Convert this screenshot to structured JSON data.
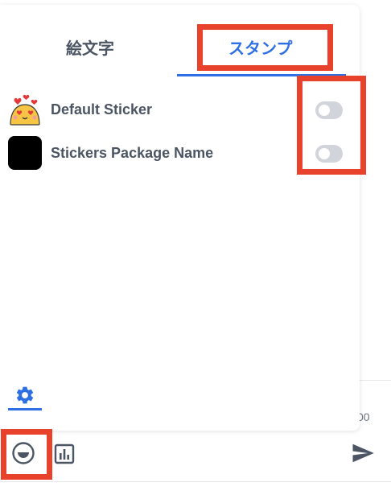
{
  "tabs": {
    "emoji_label": "絵文字",
    "stamp_label": "スタンプ"
  },
  "sticker_packages": [
    {
      "name": "Default Sticker",
      "enabled": false
    },
    {
      "name": "Stickers Package Name",
      "enabled": false
    }
  ],
  "background": {
    "counter_fragment": "00"
  },
  "icons": {
    "settings": "gear-icon",
    "emoji": "smile-icon",
    "poll": "bar-chart-icon",
    "send": "send-icon"
  },
  "colors": {
    "accent": "#2f6fe4",
    "highlight": "#e8412c",
    "toggle_off": "#d1d5db",
    "text": "#4b5563"
  }
}
